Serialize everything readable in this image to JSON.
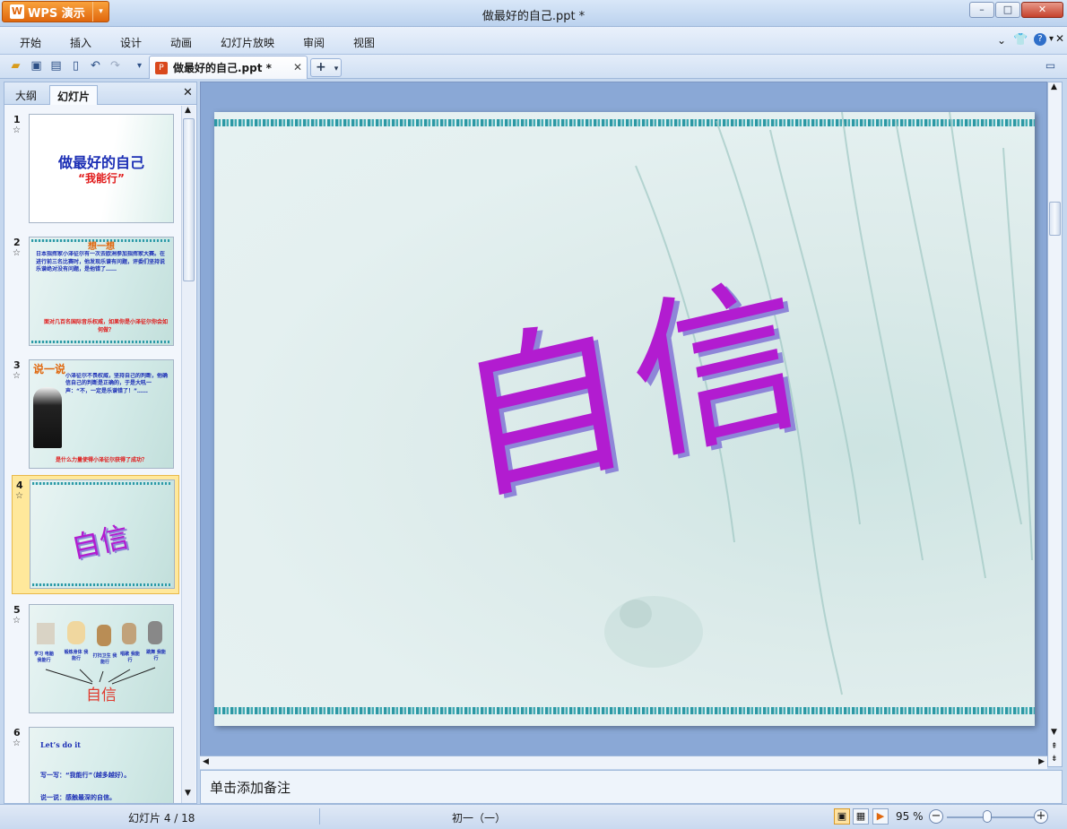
{
  "app": {
    "name": "WPS 演示",
    "window_title": "做最好的自己.ppt *",
    "wps_logo_glyph": "W"
  },
  "menu": [
    "开始",
    "插入",
    "设计",
    "动画",
    "幻灯片放映",
    "审阅",
    "视图"
  ],
  "toolbar": {
    "doc_tab_label": "做最好的自己.ppt *",
    "new_tab": "+"
  },
  "panel": {
    "tab_outline": "大纲",
    "tab_slides": "幻灯片"
  },
  "thumbnails": [
    {
      "num": "1",
      "title": "做最好的自己",
      "subtitle": "“我能行”"
    },
    {
      "num": "2",
      "heading": "想一想",
      "body": "日本指挥家小泽征尔有一次去欧洲参加指挥家大赛。在进行前三名比赛时，他发现乐谱有问题，评委们坚持说乐谱绝对没有问题，是他错了……",
      "question": "面对几百名国际音乐权威，如果你是小泽征尔你会如何做？"
    },
    {
      "num": "3",
      "heading": "说一说",
      "body": "小泽征尔不畏权威，坚持自己的判断，他确信自己的判断是正确的，于是大吼一声：“不，一定是乐谱错了！”……",
      "question": "是什么力量使得小泽征尔获得了成功？"
    },
    {
      "num": "4",
      "word": "自信"
    },
    {
      "num": "5",
      "captions": [
        "学习 电脑 我能行",
        "锻炼身体 我能行",
        "打扫卫生 我能行",
        "唱歌 我能行",
        "跳舞 我能行"
      ],
      "word": "自信"
    },
    {
      "num": "6",
      "line1": "Let’s do it",
      "line2": "写一写：“我能行”（越多越好）。",
      "line3": "说一说：感触最深的自信。"
    }
  ],
  "slide": {
    "word": "自信"
  },
  "notes": {
    "placeholder": "单击添加备注"
  },
  "status": {
    "slide_counter": "幻灯片 4 / 18",
    "section": "初一（一）",
    "zoom": "95 %"
  },
  "colors": {
    "accent_orange": "#e0670d",
    "slide_word": "#b21cd0",
    "word_shadow": "#8e86d8",
    "selected_thumb": "#ffe89b"
  }
}
